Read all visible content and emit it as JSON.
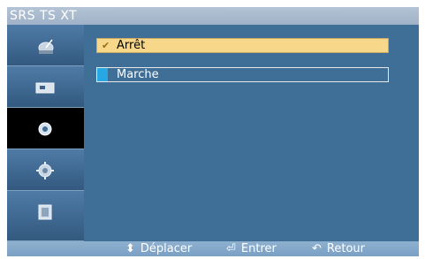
{
  "title": "SRS TS XT",
  "sidebar": {
    "items": [
      {
        "icon": "antenna-dish-icon",
        "active": false
      },
      {
        "icon": "picture-icon",
        "active": false
      },
      {
        "icon": "speaker-icon",
        "active": true
      },
      {
        "icon": "gear-icon",
        "active": false
      },
      {
        "icon": "monitor-icon",
        "active": false
      }
    ]
  },
  "options": [
    {
      "label": "Arrêt",
      "selected": true,
      "checked": true
    },
    {
      "label": "Marche",
      "selected": false,
      "checked": false
    }
  ],
  "hints": {
    "move_glyph": "⬍",
    "move": "Déplacer",
    "enter_glyph": "⏎",
    "enter": "Entrer",
    "return_glyph": "↶",
    "return": "Retour"
  },
  "colors": {
    "panel": "#3f6e97",
    "selected": "#f7d88a",
    "active_sidebar": "#000000",
    "accent": "#27a7e4"
  }
}
